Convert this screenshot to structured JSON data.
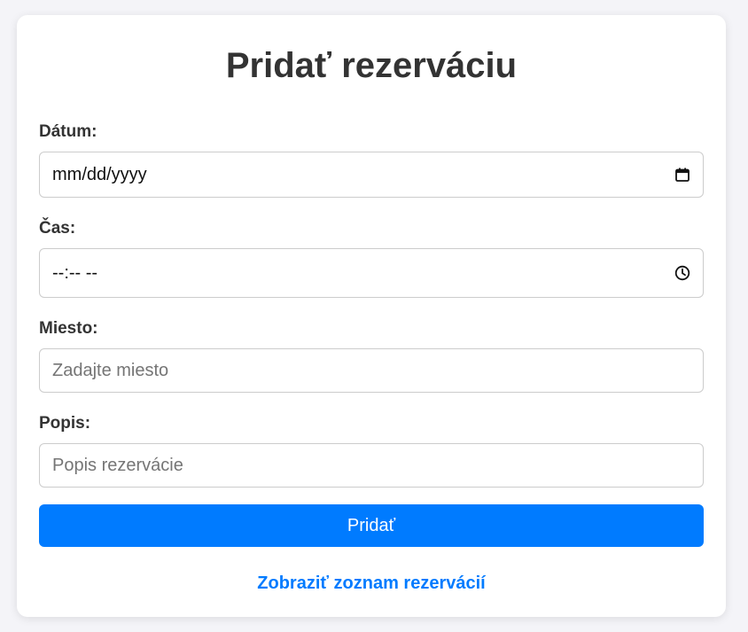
{
  "form": {
    "title": "Pridať rezerváciu",
    "date": {
      "label": "Dátum:",
      "value": "mm/dd/yyyy"
    },
    "time": {
      "label": "Čas:",
      "value": "--:-- --"
    },
    "location": {
      "label": "Miesto:",
      "placeholder": "Zadajte miesto",
      "value": ""
    },
    "description": {
      "label": "Popis:",
      "placeholder": "Popis rezervácie",
      "value": ""
    },
    "submit_label": "Pridať",
    "list_link_label": "Zobraziť zoznam rezervácií"
  },
  "colors": {
    "page_background": "#f4f4f8",
    "card_background": "#ffffff",
    "accent": "#007bff",
    "text": "#333333",
    "border": "#cccccc",
    "placeholder": "#757575"
  },
  "icons": {
    "date_picker": "calendar-icon",
    "time_picker": "clock-icon"
  }
}
